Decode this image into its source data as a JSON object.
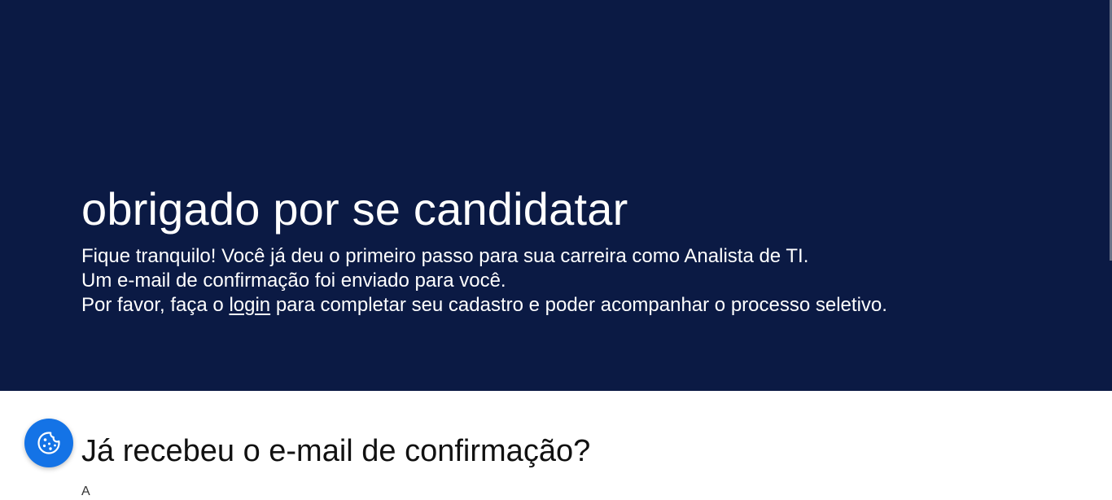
{
  "hero": {
    "title": "obrigado por se candidatar",
    "line1": "Fique tranquilo! Você já deu o primeiro passo para sua carreira como Analista de TI.",
    "line2": "Um e-mail de confirmação foi enviado para você.",
    "line3_prefix": "Por favor, faça o ",
    "login_link": "login",
    "line3_suffix": " para completar seu cadastro e poder acompanhar o processo seletivo."
  },
  "section": {
    "title": "Já recebeu o e-mail de confirmação?",
    "subtitle": "A"
  },
  "cookie_button": {
    "icon": "cookie-icon"
  },
  "colors": {
    "hero_background": "#0b1a44",
    "cookie_button": "#1473e6"
  }
}
